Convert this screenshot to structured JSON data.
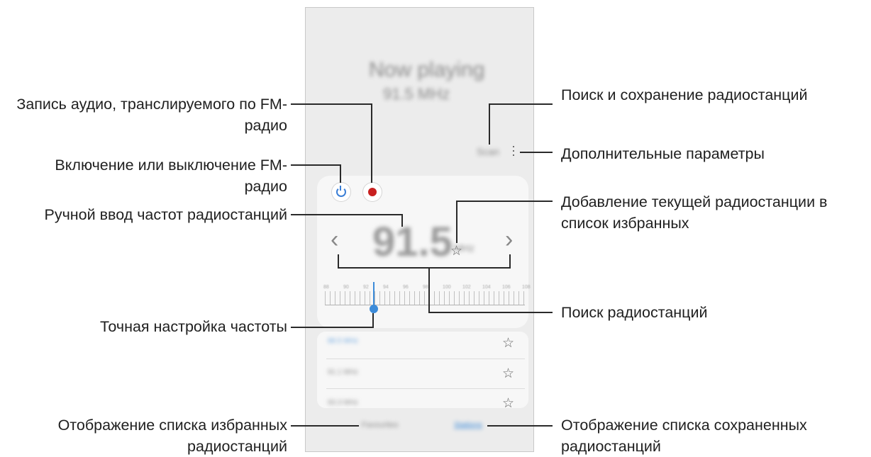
{
  "callouts": {
    "record_audio": "Запись аудио, транслируемого по FM-радио",
    "power": "Включение или выключение FM-радио",
    "manual_input": "Ручной ввод частот радиостанций",
    "fine_tune": "Точная настройка частоты",
    "favorites_list": "Отображение списка избранных радиостанций",
    "scan_save": "Поиск и сохранение радиостанций",
    "more_options": "Дополнительные параметры",
    "add_favorite": "Добавление текущей радиостанции в список избранных",
    "search_stations": "Поиск радиостанций",
    "saved_list": "Отображение списка сохраненных радиостанций"
  },
  "screen": {
    "now_playing": "Now playing",
    "now_playing_freq": "91.5 MHz",
    "scan_button": "Scan",
    "big_frequency": "91.5",
    "big_unit": "MHz",
    "scale_labels": [
      "88",
      "90",
      "92",
      "94",
      "96",
      "98",
      "100",
      "102",
      "104",
      "106",
      "108"
    ],
    "stations": [
      "88.5 MHz",
      "91.1 MHz",
      "93.3 MHz"
    ],
    "tab_favorites": "Favourites",
    "tab_stations": "Stations"
  },
  "colors": {
    "accent_blue": "#3c8bd9",
    "record_red": "#c8201f"
  }
}
